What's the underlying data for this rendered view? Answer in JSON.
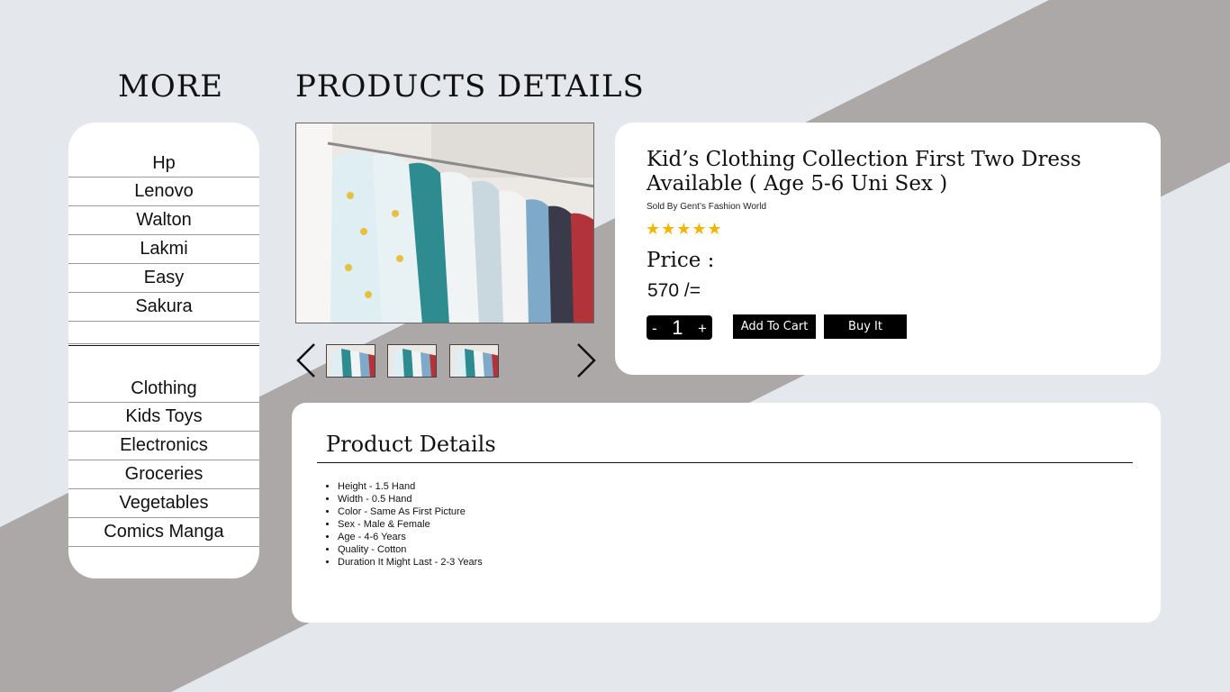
{
  "headings": {
    "more": "MORE",
    "products_details": "PRODUCTS  DETAILS"
  },
  "sidebar": {
    "brands": [
      "Hp",
      "Lenovo",
      "Walton",
      "Lakmi",
      "Easy",
      "Sakura"
    ],
    "categories": [
      "Clothing",
      "Kids Toys",
      "Electronics",
      "Groceries",
      "Vegetables",
      "Comics Manga"
    ]
  },
  "product": {
    "title": "Kid’s Clothing Collection First Two Dress Available ( Age 5-6 Uni Sex )",
    "seller": "Sold By Gent’s Fashion World",
    "rating": 5,
    "rating_stars": "★★★★★",
    "price_label": "Price :",
    "price_value": "570 /=",
    "quantity": {
      "minus": "-",
      "value": "1",
      "plus": "+"
    },
    "add_to_cart": "Add To Cart",
    "buy_it": "Buy It"
  },
  "details": {
    "title": "Product Details",
    "items": [
      "Height - 1.5 Hand",
      "Width - 0.5 Hand",
      "Color - Same As First Picture",
      "Sex - Male & Female",
      "Age - 4-6 Years",
      "Quality - Cotton",
      "Duration It Might Last - 2-3 Years"
    ]
  },
  "colors": {
    "background": "#e4e8ec",
    "diagonal_band": "#aca8a8",
    "star": "#f2b400",
    "button": "#000000"
  },
  "icons": {
    "prev": "chevron-left-icon",
    "next": "chevron-right-icon"
  }
}
